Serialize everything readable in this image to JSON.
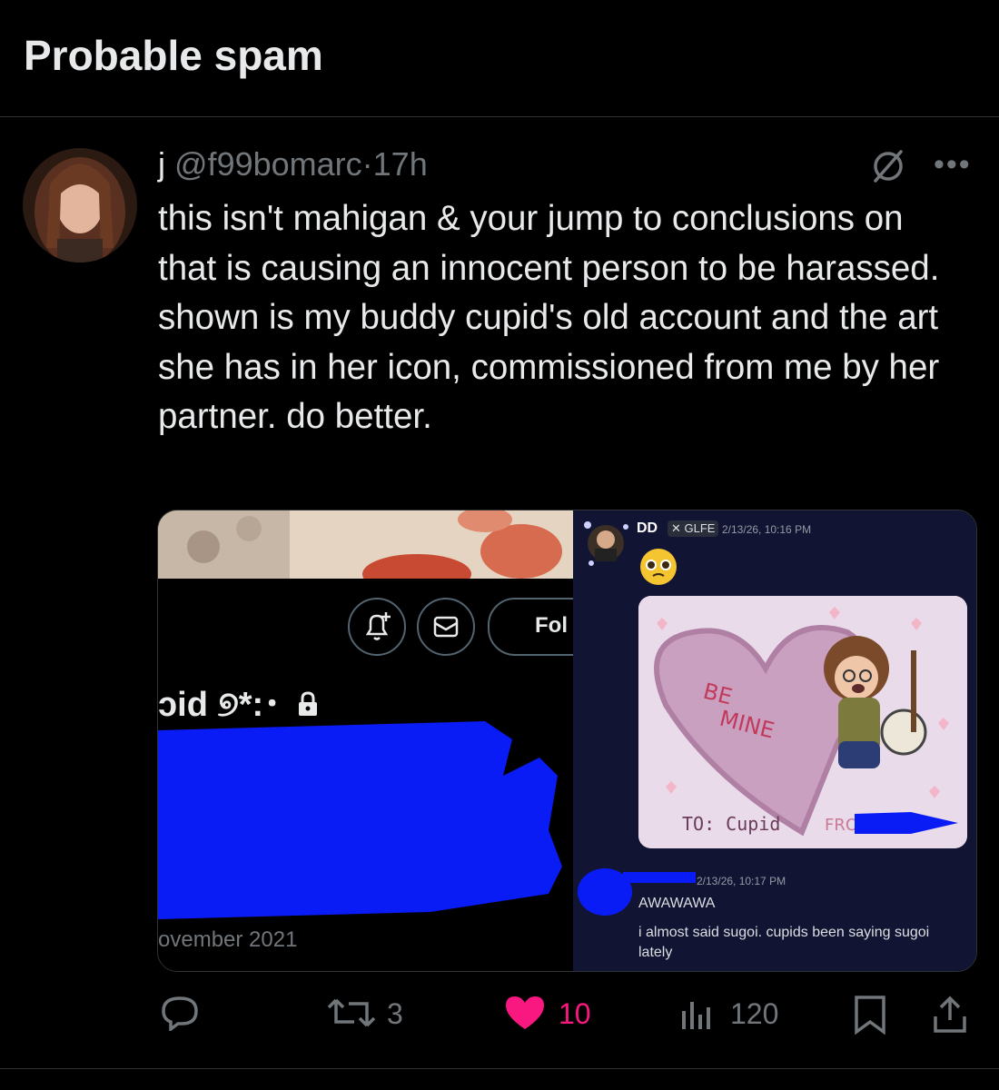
{
  "header": {
    "title": "Probable spam"
  },
  "tweet": {
    "display_name": "j",
    "handle": "@f99bomarc",
    "separator": "·",
    "time": "17h",
    "text": "this isn't mahigan & your jump to conclusions on that is causing an innocent person to be harassed. shown is my buddy cupid's old account and the art she has in her icon, commissioned from me by her partner. do better."
  },
  "media": {
    "left": {
      "follow_label": "Fol",
      "handle_fragment": "ɔid ୭*:･",
      "joined_fragment": "ovember 2021"
    },
    "right": {
      "author": "DD",
      "tag": "GLFE",
      "timestamp": "2/13/26, 10:16 PM",
      "art_text_be": "BE",
      "art_text_mine": "MINE",
      "art_text_to": "TO: Cupid",
      "art_text_from": "FROM",
      "reply_timestamp": "2/13/26, 10:17 PM",
      "reply_line1": "AWAWAWA",
      "reply_line2": "i almost said sugoi. cupids been saying sugoi lately"
    }
  },
  "actions": {
    "replies": "",
    "reposts": "3",
    "likes": "10",
    "views": "120"
  },
  "colors": {
    "background": "#000000",
    "text": "#e7e9ea",
    "secondary": "#71767b",
    "like": "#f91880",
    "redaction": "#0a1cf5",
    "discord_bg": "#111433"
  }
}
